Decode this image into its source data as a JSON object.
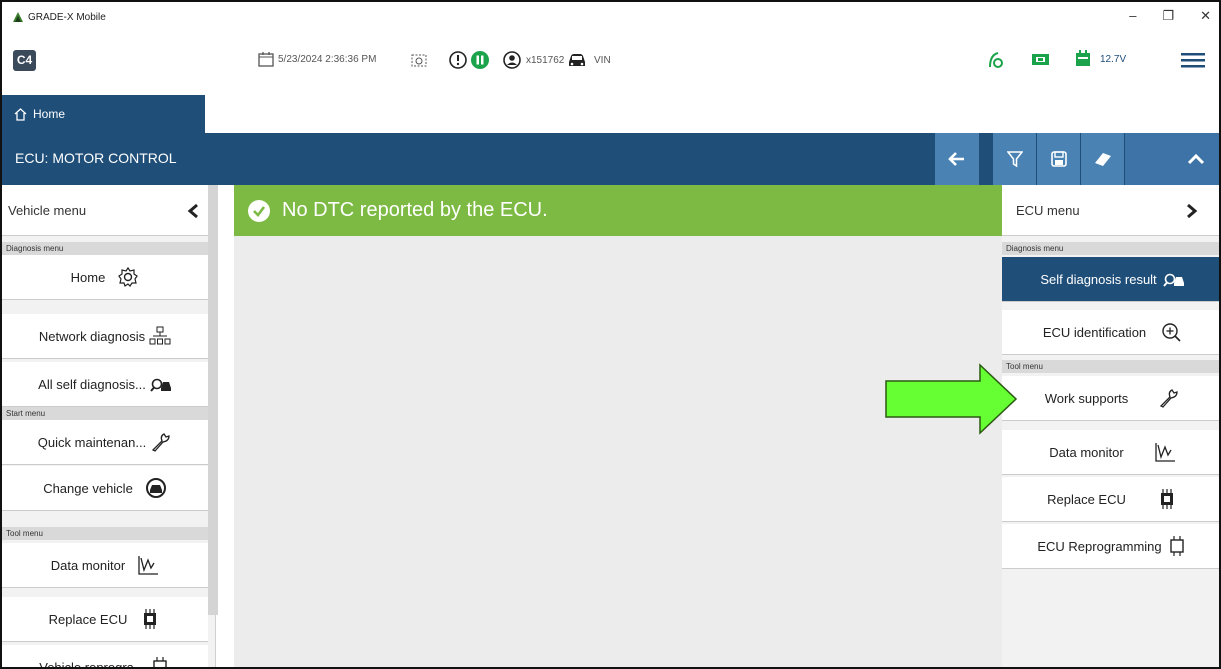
{
  "app": {
    "title": "GRADE-X Mobile",
    "logo_text": "C4"
  },
  "toolbar": {
    "datetime": "5/23/2024 2:36:36 PM",
    "user": "x151762",
    "vin": "VIN",
    "voltage": "12.7V",
    "icons": [
      "calendar-icon",
      "camera-icon",
      "alert-icon",
      "pause-icon",
      "user-icon",
      "car-icon",
      "signal-icon",
      "battery-icon",
      "vci-icon",
      "menu-icon"
    ]
  },
  "tabs": [
    {
      "label": "Home",
      "icon": "home-icon"
    }
  ],
  "header": {
    "title": "ECU: MOTOR CONTROL",
    "buttons": [
      "back-icon",
      "filter-icon",
      "save-icon",
      "eraser-icon",
      "collapse-icon"
    ]
  },
  "left_panel": {
    "head": "Vehicle menu",
    "sections": {
      "diagnosis": "Diagnosis menu",
      "start": "Start menu",
      "tool": "Tool menu"
    },
    "items": {
      "home": "Home",
      "network": "Network diagnosis",
      "all_self": "All self diagnosis...",
      "quick": "Quick maintenan...",
      "change": "Change vehicle",
      "data_monitor": "Data monitor",
      "replace_ecu": "Replace ECU",
      "vehicle_reprog": "Vehicle reprogra..."
    }
  },
  "banner": {
    "text": "No DTC reported by the ECU.",
    "color": "#7cba43"
  },
  "right_panel": {
    "head": "ECU menu",
    "sections": {
      "diagnosis": "Diagnosis menu",
      "tool": "Tool menu"
    },
    "items": {
      "self_diag": "Self diagnosis result",
      "ecu_id": "ECU identification",
      "work_supports": "Work supports",
      "data_monitor": "Data monitor",
      "replace_ecu": "Replace ECU",
      "ecu_reprog": "ECU Reprogramming"
    }
  },
  "colors": {
    "primary": "#1f4e79",
    "header_button": "#4b82b4",
    "arrow": "#66ff33"
  }
}
